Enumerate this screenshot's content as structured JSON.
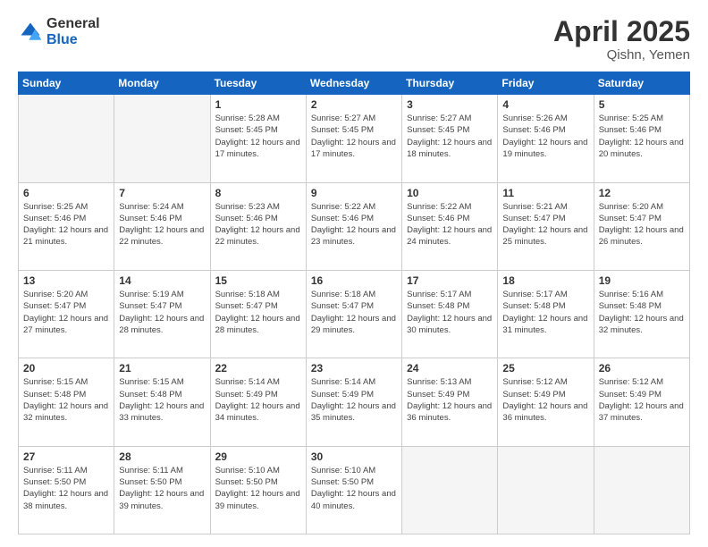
{
  "logo": {
    "general": "General",
    "blue": "Blue"
  },
  "title": "April 2025",
  "location": "Qishn, Yemen",
  "days_of_week": [
    "Sunday",
    "Monday",
    "Tuesday",
    "Wednesday",
    "Thursday",
    "Friday",
    "Saturday"
  ],
  "weeks": [
    [
      {
        "day": "",
        "info": ""
      },
      {
        "day": "",
        "info": ""
      },
      {
        "day": "1",
        "info": "Sunrise: 5:28 AM\nSunset: 5:45 PM\nDaylight: 12 hours and 17 minutes."
      },
      {
        "day": "2",
        "info": "Sunrise: 5:27 AM\nSunset: 5:45 PM\nDaylight: 12 hours and 17 minutes."
      },
      {
        "day": "3",
        "info": "Sunrise: 5:27 AM\nSunset: 5:45 PM\nDaylight: 12 hours and 18 minutes."
      },
      {
        "day": "4",
        "info": "Sunrise: 5:26 AM\nSunset: 5:46 PM\nDaylight: 12 hours and 19 minutes."
      },
      {
        "day": "5",
        "info": "Sunrise: 5:25 AM\nSunset: 5:46 PM\nDaylight: 12 hours and 20 minutes."
      }
    ],
    [
      {
        "day": "6",
        "info": "Sunrise: 5:25 AM\nSunset: 5:46 PM\nDaylight: 12 hours and 21 minutes."
      },
      {
        "day": "7",
        "info": "Sunrise: 5:24 AM\nSunset: 5:46 PM\nDaylight: 12 hours and 22 minutes."
      },
      {
        "day": "8",
        "info": "Sunrise: 5:23 AM\nSunset: 5:46 PM\nDaylight: 12 hours and 22 minutes."
      },
      {
        "day": "9",
        "info": "Sunrise: 5:22 AM\nSunset: 5:46 PM\nDaylight: 12 hours and 23 minutes."
      },
      {
        "day": "10",
        "info": "Sunrise: 5:22 AM\nSunset: 5:46 PM\nDaylight: 12 hours and 24 minutes."
      },
      {
        "day": "11",
        "info": "Sunrise: 5:21 AM\nSunset: 5:47 PM\nDaylight: 12 hours and 25 minutes."
      },
      {
        "day": "12",
        "info": "Sunrise: 5:20 AM\nSunset: 5:47 PM\nDaylight: 12 hours and 26 minutes."
      }
    ],
    [
      {
        "day": "13",
        "info": "Sunrise: 5:20 AM\nSunset: 5:47 PM\nDaylight: 12 hours and 27 minutes."
      },
      {
        "day": "14",
        "info": "Sunrise: 5:19 AM\nSunset: 5:47 PM\nDaylight: 12 hours and 28 minutes."
      },
      {
        "day": "15",
        "info": "Sunrise: 5:18 AM\nSunset: 5:47 PM\nDaylight: 12 hours and 28 minutes."
      },
      {
        "day": "16",
        "info": "Sunrise: 5:18 AM\nSunset: 5:47 PM\nDaylight: 12 hours and 29 minutes."
      },
      {
        "day": "17",
        "info": "Sunrise: 5:17 AM\nSunset: 5:48 PM\nDaylight: 12 hours and 30 minutes."
      },
      {
        "day": "18",
        "info": "Sunrise: 5:17 AM\nSunset: 5:48 PM\nDaylight: 12 hours and 31 minutes."
      },
      {
        "day": "19",
        "info": "Sunrise: 5:16 AM\nSunset: 5:48 PM\nDaylight: 12 hours and 32 minutes."
      }
    ],
    [
      {
        "day": "20",
        "info": "Sunrise: 5:15 AM\nSunset: 5:48 PM\nDaylight: 12 hours and 32 minutes."
      },
      {
        "day": "21",
        "info": "Sunrise: 5:15 AM\nSunset: 5:48 PM\nDaylight: 12 hours and 33 minutes."
      },
      {
        "day": "22",
        "info": "Sunrise: 5:14 AM\nSunset: 5:49 PM\nDaylight: 12 hours and 34 minutes."
      },
      {
        "day": "23",
        "info": "Sunrise: 5:14 AM\nSunset: 5:49 PM\nDaylight: 12 hours and 35 minutes."
      },
      {
        "day": "24",
        "info": "Sunrise: 5:13 AM\nSunset: 5:49 PM\nDaylight: 12 hours and 36 minutes."
      },
      {
        "day": "25",
        "info": "Sunrise: 5:12 AM\nSunset: 5:49 PM\nDaylight: 12 hours and 36 minutes."
      },
      {
        "day": "26",
        "info": "Sunrise: 5:12 AM\nSunset: 5:49 PM\nDaylight: 12 hours and 37 minutes."
      }
    ],
    [
      {
        "day": "27",
        "info": "Sunrise: 5:11 AM\nSunset: 5:50 PM\nDaylight: 12 hours and 38 minutes."
      },
      {
        "day": "28",
        "info": "Sunrise: 5:11 AM\nSunset: 5:50 PM\nDaylight: 12 hours and 39 minutes."
      },
      {
        "day": "29",
        "info": "Sunrise: 5:10 AM\nSunset: 5:50 PM\nDaylight: 12 hours and 39 minutes."
      },
      {
        "day": "30",
        "info": "Sunrise: 5:10 AM\nSunset: 5:50 PM\nDaylight: 12 hours and 40 minutes."
      },
      {
        "day": "",
        "info": ""
      },
      {
        "day": "",
        "info": ""
      },
      {
        "day": "",
        "info": ""
      }
    ]
  ]
}
